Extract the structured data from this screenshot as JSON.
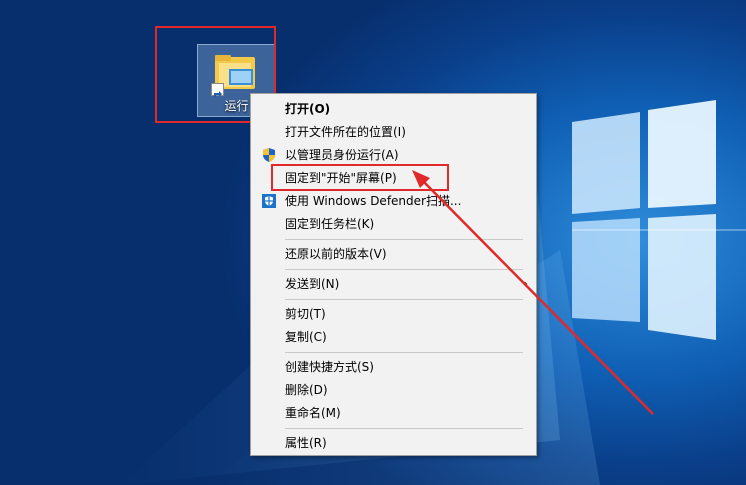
{
  "desktop": {
    "icon_label": "运行"
  },
  "context_menu": {
    "items": [
      {
        "label": "打开(O)"
      },
      {
        "label": "打开文件所在的位置(I)"
      },
      {
        "label": "以管理员身份运行(A)"
      },
      {
        "label": "固定到\"开始\"屏幕(P)"
      },
      {
        "label": "使用 Windows Defender扫描..."
      },
      {
        "label": "固定到任务栏(K)"
      },
      {
        "label": "还原以前的版本(V)"
      },
      {
        "label": "发送到(N)"
      },
      {
        "label": "剪切(T)"
      },
      {
        "label": "复制(C)"
      },
      {
        "label": "创建快捷方式(S)"
      },
      {
        "label": "删除(D)"
      },
      {
        "label": "重命名(M)"
      },
      {
        "label": "属性(R)"
      }
    ],
    "submenu_arrow": "›"
  },
  "colors": {
    "annotation_red": "#e02a2a",
    "menu_bg": "#f2f2f2"
  }
}
